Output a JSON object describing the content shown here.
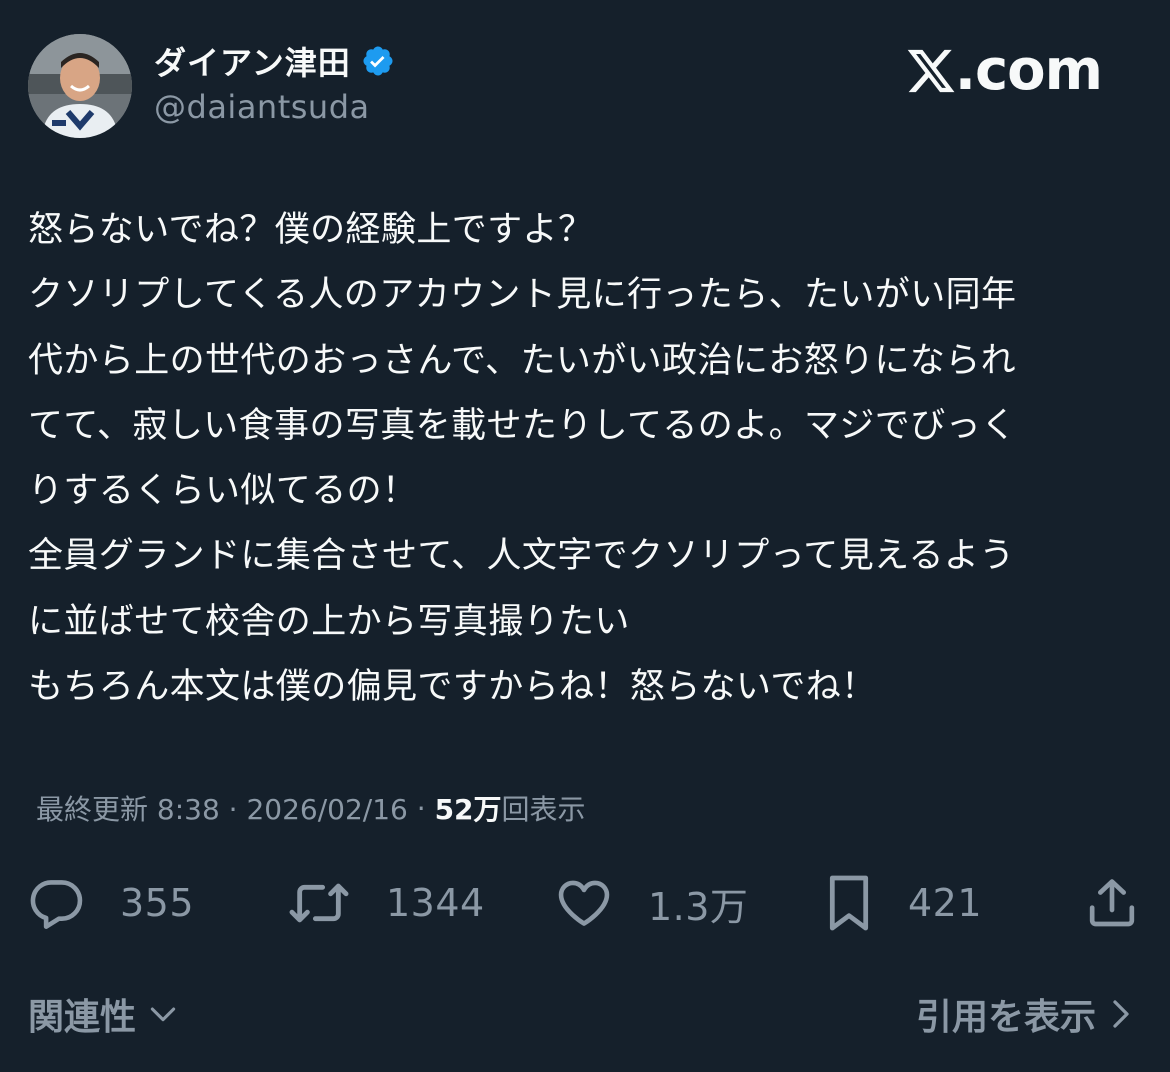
{
  "author": {
    "display_name": "ダイアン津田",
    "handle": "@daiantsuda",
    "verified": true
  },
  "brand": {
    "text": ".com",
    "icon": "x-logo-icon"
  },
  "tweet": {
    "lines": [
      "怒らないでね？僕の経験上ですよ？",
      "クソリプしてくる人のアカウント見に行ったら、たいがい同年",
      "代から上の世代のおっさんで、たいがい政治にお怒りになられ",
      "てて、寂しい食事の写真を載せたりしてるのよ。マジでびっく",
      "りするくらい似てるの！",
      "全員グランドに集合させて、人文字でクソリプって見えるよう",
      "に並ばせて校舎の上から写真撮りたい",
      "もちろん本文は僕の偏見ですからね！怒らないでね！"
    ]
  },
  "meta": {
    "updated_label": "最終更新 8:38 · 2026/02/16",
    "separator": " · ",
    "views_num": "52万",
    "views_label": "回表示"
  },
  "actions": {
    "reply": {
      "count": "355",
      "icon": "reply-icon"
    },
    "retweet": {
      "count": "1344",
      "icon": "retweet-icon"
    },
    "like": {
      "count": "1.3万",
      "icon": "heart-icon"
    },
    "bookmark": {
      "count": "421",
      "icon": "bookmark-icon"
    },
    "share": {
      "icon": "share-icon"
    }
  },
  "footer": {
    "related_label": "関連性",
    "quotes_label": "引用を表示"
  },
  "colors": {
    "background": "#15202b",
    "text": "#f7f9f9",
    "muted": "#8b98a5",
    "verified": "#1d9bf0"
  }
}
